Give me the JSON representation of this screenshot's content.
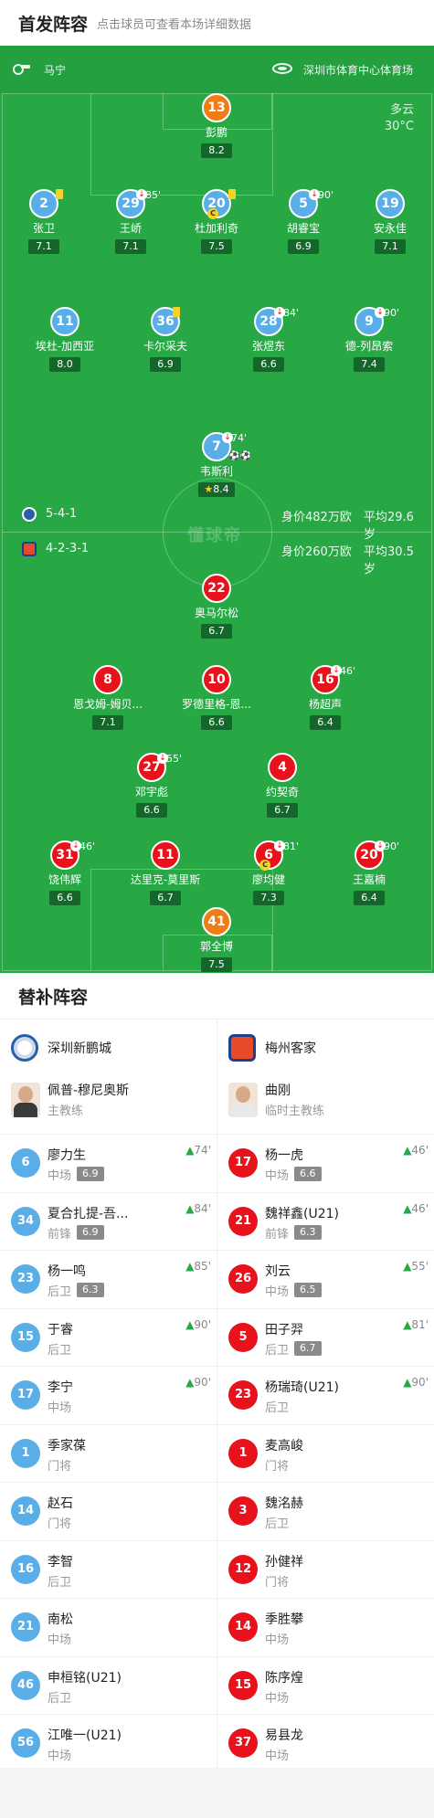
{
  "header": {
    "title": "首发阵容",
    "subtitle": "点击球员可查看本场详细数据"
  },
  "match": {
    "referee": "马宁",
    "venue": "深圳市体育中心体育场",
    "weather": "多云",
    "temperature": "30°C",
    "watermark": "懂球帝"
  },
  "home": {
    "formation": "5-4-1",
    "value": "身价482万欧",
    "avg_age": "平均29.6岁",
    "color": "#5aaee8"
  },
  "away": {
    "formation": "4-2-3-1",
    "value": "身价260万欧",
    "avg_age": "平均30.5岁",
    "color": "#e8121c"
  },
  "players": {
    "h13": {
      "num": "13",
      "name": "彭鹏",
      "rating": "8.2"
    },
    "h2": {
      "num": "2",
      "name": "张卫",
      "rating": "7.1"
    },
    "h29": {
      "num": "29",
      "name": "王峤",
      "rating": "7.1",
      "sub": "85'"
    },
    "h20": {
      "num": "20",
      "name": "杜加利奇",
      "rating": "7.5",
      "cap": "C"
    },
    "h5": {
      "num": "5",
      "name": "胡睿宝",
      "rating": "6.9",
      "sub": "90'"
    },
    "h19": {
      "num": "19",
      "name": "安永佳",
      "rating": "7.1"
    },
    "h11": {
      "num": "11",
      "name": "埃杜-加西亚",
      "rating": "8.0"
    },
    "h36": {
      "num": "36",
      "name": "卡尔采夫",
      "rating": "6.9"
    },
    "h28": {
      "num": "28",
      "name": "张煜东",
      "rating": "6.6",
      "sub": "84'"
    },
    "h9": {
      "num": "9",
      "name": "德-列昂索",
      "rating": "7.4",
      "sub": "90'"
    },
    "h7": {
      "num": "7",
      "name": "韦斯利",
      "rating": "8.4",
      "sub": "74'"
    },
    "a22": {
      "num": "22",
      "name": "奥马尔松",
      "rating": "6.7"
    },
    "a8": {
      "num": "8",
      "name": "恩戈姆-姆贝...",
      "rating": "7.1"
    },
    "a10": {
      "num": "10",
      "name": "罗德里格-恩...",
      "rating": "6.6"
    },
    "a16": {
      "num": "16",
      "name": "杨超声",
      "rating": "6.4",
      "sub": "46'"
    },
    "a27": {
      "num": "27",
      "name": "邓宇彪",
      "rating": "6.6",
      "sub": "55'"
    },
    "a4": {
      "num": "4",
      "name": "约契奇",
      "rating": "6.7"
    },
    "a31": {
      "num": "31",
      "name": "饶伟辉",
      "rating": "6.6",
      "sub": "46'"
    },
    "a11": {
      "num": "11",
      "name": "达里克-莫里斯",
      "rating": "6.7"
    },
    "a6": {
      "num": "6",
      "name": "廖均健",
      "rating": "7.3",
      "sub": "81'",
      "cap": "C"
    },
    "a20": {
      "num": "20",
      "name": "王嘉楠",
      "rating": "6.4",
      "sub": "90'"
    },
    "a41": {
      "num": "41",
      "name": "郭全博",
      "rating": "7.5"
    }
  },
  "subs_section": {
    "title": "替补阵容"
  },
  "home_team": {
    "name": "深圳新鹏城",
    "coach": "佩普-穆尼奥斯",
    "coach_role": "主教练"
  },
  "away_team": {
    "name": "梅州客家",
    "coach": "曲刚",
    "coach_role": "临时主教练"
  },
  "home_subs": [
    {
      "num": "6",
      "name": "廖力生",
      "pos": "中场",
      "rating": "6.9",
      "on": "74'"
    },
    {
      "num": "34",
      "name": "夏合扎提-吾...",
      "pos": "前锋",
      "rating": "6.9",
      "on": "84'"
    },
    {
      "num": "23",
      "name": "杨一鸣",
      "pos": "后卫",
      "rating": "6.3",
      "on": "85'"
    },
    {
      "num": "15",
      "name": "于睿",
      "pos": "后卫",
      "on": "90'"
    },
    {
      "num": "17",
      "name": "李宁",
      "pos": "中场",
      "on": "90'"
    },
    {
      "num": "1",
      "name": "季家葆",
      "pos": "门将"
    },
    {
      "num": "14",
      "name": "赵石",
      "pos": "门将"
    },
    {
      "num": "16",
      "name": "李智",
      "pos": "后卫"
    },
    {
      "num": "21",
      "name": "南松",
      "pos": "中场"
    },
    {
      "num": "46",
      "name": "申桓铭(U21)",
      "pos": "后卫"
    },
    {
      "num": "56",
      "name": "江唯一(U21)",
      "pos": "中场"
    }
  ],
  "away_subs": [
    {
      "num": "17",
      "name": "杨一虎",
      "pos": "中场",
      "rating": "6.6",
      "on": "46'"
    },
    {
      "num": "21",
      "name": "魏祥鑫(U21)",
      "pos": "前锋",
      "rating": "6.3",
      "on": "46'"
    },
    {
      "num": "26",
      "name": "刘云",
      "pos": "中场",
      "rating": "6.5",
      "on": "55'"
    },
    {
      "num": "5",
      "name": "田子羿",
      "pos": "后卫",
      "rating": "6.7",
      "on": "81'"
    },
    {
      "num": "23",
      "name": "杨瑞琦(U21)",
      "pos": "后卫",
      "on": "90'"
    },
    {
      "num": "1",
      "name": "麦高峻",
      "pos": "门将"
    },
    {
      "num": "3",
      "name": "魏洺赫",
      "pos": "后卫"
    },
    {
      "num": "12",
      "name": "孙健祥",
      "pos": "门将"
    },
    {
      "num": "14",
      "name": "季胜攀",
      "pos": "中场"
    },
    {
      "num": "15",
      "name": "陈序煌",
      "pos": "中场"
    },
    {
      "num": "37",
      "name": "易县龙",
      "pos": "中场"
    }
  ],
  "icons": {
    "up": "▲",
    "sub_out": "↓",
    "whistle": "whistle-icon",
    "stadium": "stadium-icon"
  }
}
